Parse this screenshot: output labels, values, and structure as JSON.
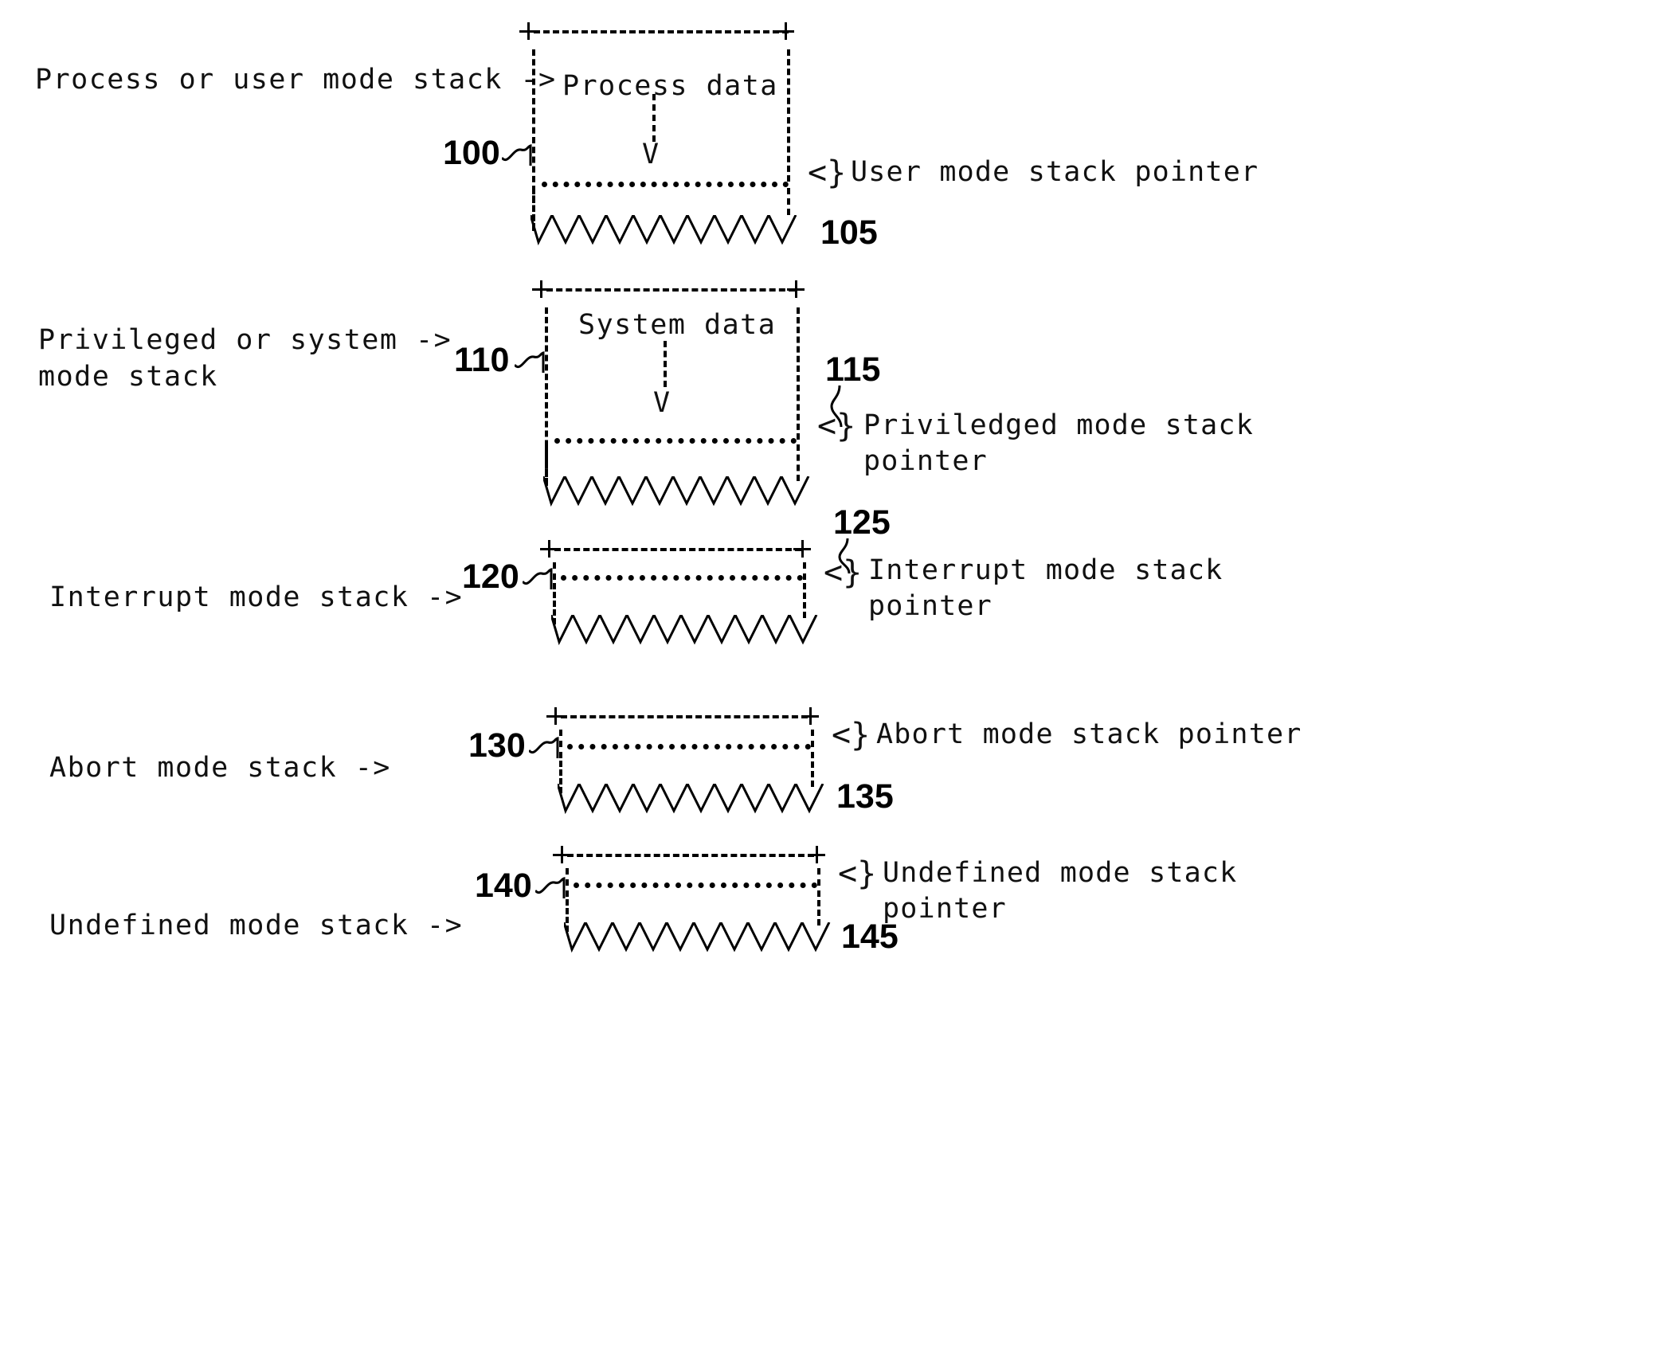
{
  "figure": {
    "title": "Process and privileged mode stack layout diagram",
    "background_color": "#ffffff",
    "ink_color": "#000000"
  },
  "sections": [
    {
      "id": "user-mode",
      "left_label": "Process or user mode stack ->",
      "box_text": "Process data",
      "arrow_glyph": "V",
      "ref_number": "100",
      "pointer_ref_number": "105",
      "pointer_glyph": "<}",
      "right_label": "User mode stack pointer",
      "has_data_region": true,
      "hatch_glyph": "\\/\\/\\/\\/\\/\\/\\/\\/\\/"
    },
    {
      "id": "system-mode",
      "left_label": "Privileged or system ->\nmode stack",
      "box_text": "System data",
      "arrow_glyph": "V",
      "ref_number": "110",
      "pointer_ref_number": "115",
      "pointer_glyph": "<}",
      "right_label": "Priviledged mode stack\npointer",
      "has_data_region": true,
      "hatch_glyph": "\\/\\/\\/\\/\\/\\/\\/\\/\\/"
    },
    {
      "id": "interrupt-mode",
      "left_label": "Interrupt mode stack ->",
      "box_text": "",
      "arrow_glyph": "",
      "ref_number": "120",
      "pointer_ref_number": "125",
      "pointer_glyph": "<}",
      "right_label": "Interrupt mode stack\npointer",
      "has_data_region": false,
      "hatch_glyph": "\\/\\/\\/\\/\\/\\/\\/\\/\\/"
    },
    {
      "id": "abort-mode",
      "left_label": "Abort mode stack ->",
      "box_text": "",
      "arrow_glyph": "",
      "ref_number": "130",
      "pointer_ref_number": "135",
      "pointer_glyph": "<}",
      "right_label": "Abort mode stack pointer",
      "has_data_region": false,
      "hatch_glyph": "\\/\\/\\/\\/\\/\\/\\/\\/\\/"
    },
    {
      "id": "undefined-mode",
      "left_label": "Undefined mode stack ->",
      "box_text": "",
      "arrow_glyph": "",
      "ref_number": "140",
      "pointer_ref_number": "145",
      "pointer_glyph": "<}",
      "right_label": "Undefined mode stack\npointer",
      "has_data_region": false,
      "hatch_glyph": "\\/\\/\\/\\/\\/\\/\\/\\/\\/"
    }
  ]
}
